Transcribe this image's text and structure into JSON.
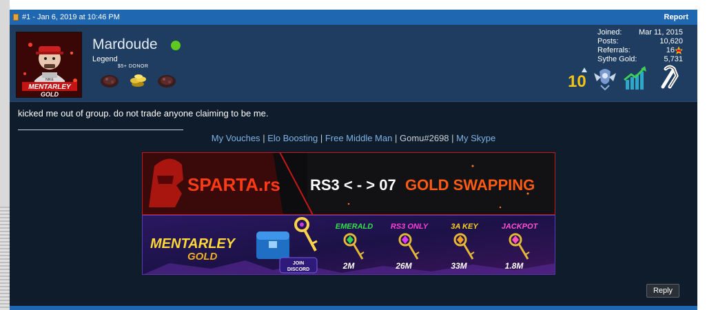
{
  "post": {
    "number_date": "#1 - Jan 6, 2019 at 10:46 PM",
    "report_label": "Report",
    "reply_label": "Reply",
    "message": "kicked me out of group. do not trade anyone claiming to be me."
  },
  "user": {
    "name": "Mardoude",
    "title": "Legend",
    "badge_caption": "$5+ DONOR",
    "online_color": "#5ec91e"
  },
  "stats": [
    {
      "label": "Joined:",
      "value": "Mar 11, 2015"
    },
    {
      "label": "Posts:",
      "value": "10,620"
    },
    {
      "label": "Referrals:",
      "value": "16"
    },
    {
      "label": "Sythe Gold:",
      "value": "5,731"
    }
  ],
  "awards": {
    "years": "10"
  },
  "signature": {
    "links": [
      {
        "label": "My Vouches",
        "link": true
      },
      {
        "label": "Elo Boosting",
        "link": true
      },
      {
        "label": "Free Middle Man",
        "link": true
      },
      {
        "label": "Gomu#2698",
        "link": false
      },
      {
        "label": "My Skype",
        "link": true
      }
    ]
  },
  "avatar": {
    "line1": "MENTARLEY",
    "line2": "GOLD",
    "tag": "NIKE"
  },
  "banner_sparta": {
    "brand": "SPARTA.rs",
    "text_white": "RS3 < - > 07",
    "text_orange": "GOLD SWAPPING"
  },
  "banner_mentarley": {
    "brand_line1": "MENTARLEY",
    "brand_line2": "GOLD",
    "join_line1": "JOIN",
    "join_line2": "DISCORD",
    "keys": [
      {
        "label": "EMERALD",
        "price": "2M",
        "label_color": "#33e04a",
        "gem_color": "#2fd24a"
      },
      {
        "label": "RS3 ONLY",
        "price": "26M",
        "label_color": "#ff3fd8",
        "gem_color": "#d83af0"
      },
      {
        "label": "3A KEY",
        "price": "33M",
        "label_color": "#ffd11a",
        "gem_color": "#f0a020"
      },
      {
        "label": "JACKPOT",
        "price": "1.8M",
        "label_color": "#ff4fd2",
        "gem_color": "#ff54b8"
      }
    ]
  },
  "colors": {
    "header_bar": "#1f67b1",
    "user_bar": "#1e3d60",
    "post_bg": "#0f1c2b",
    "link": "#7fb2e5",
    "sparta_orange": "#ff5a14"
  }
}
